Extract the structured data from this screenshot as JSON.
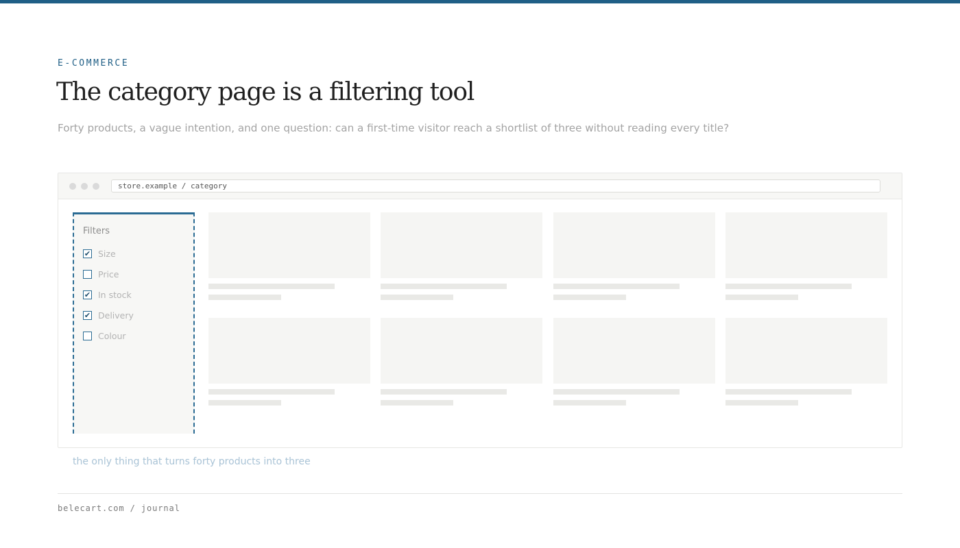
{
  "header": {
    "eyebrow": "E-COMMERCE",
    "title": "The category page is a filtering tool",
    "subtitle": "Forty products, a vague intention, and one question: can a first-time visitor reach a shortlist of three without reading every title?"
  },
  "browser": {
    "url": "store.example / category",
    "filters": {
      "title": "Filters",
      "items": [
        {
          "label": "Size",
          "checked": true
        },
        {
          "label": "Price",
          "checked": false
        },
        {
          "label": "In stock",
          "checked": true
        },
        {
          "label": "Delivery",
          "checked": true
        },
        {
          "label": "Colour",
          "checked": false
        }
      ]
    },
    "product_placeholders": 8
  },
  "caption": "the only thing that turns forty products into three",
  "footer": "belecart.com / journal",
  "colors": {
    "accent": "#205f86",
    "placeholder": "#f5f5f3",
    "caption": "#a9c3d6"
  }
}
